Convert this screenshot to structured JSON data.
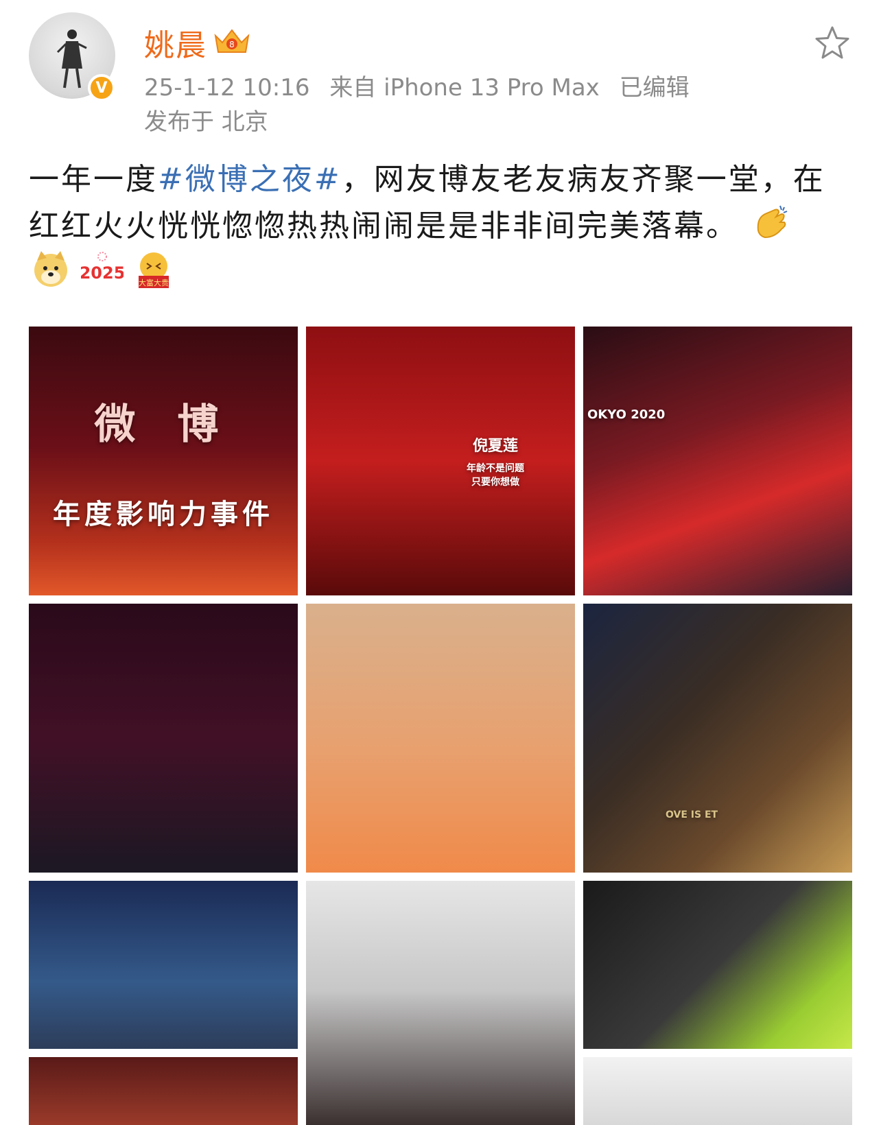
{
  "post": {
    "username": "姚晨",
    "timestamp": "25-1-12 10:16",
    "source": "来自 iPhone 13 Pro Max",
    "edited": "已编辑",
    "location": "发布于 北京",
    "text_before": "一年一度",
    "hashtag": "#微博之夜#",
    "text_after": "，网友博友老友病友齐聚一堂，在红红火火恍恍惚惚热热闹闹是是非非间完美落幕。",
    "emojis": [
      "doge-emoji",
      "2025-emoji",
      "dafu-emoji"
    ]
  },
  "colors": {
    "username": "#ef6a1a",
    "hashtag": "#3a6fb4",
    "meta": "#8b8b8b",
    "vbadge": "#f6a315"
  },
  "photos": {
    "p1": {
      "line1": "微 博",
      "line2": "年度影响力事件"
    },
    "p2": {
      "name": "倪夏莲",
      "line1": "年龄不是问题",
      "line2": "只要你想做"
    },
    "p3": {
      "text": "OKYO 2020"
    },
    "p6": {
      "text": "OVE IS ET"
    }
  }
}
